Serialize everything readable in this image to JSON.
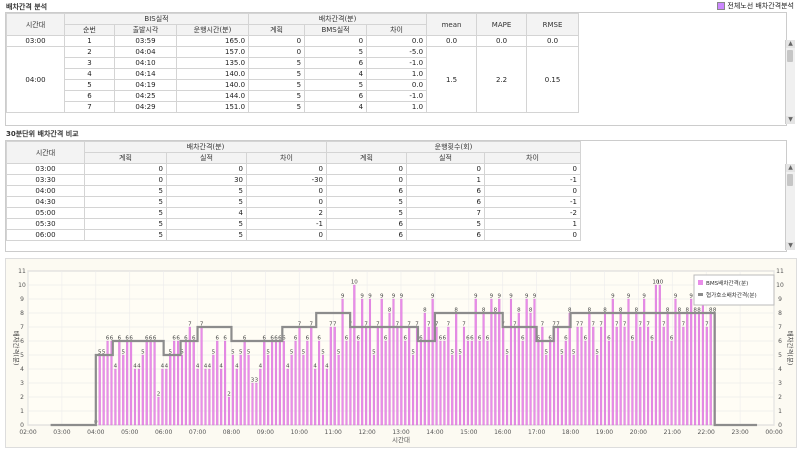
{
  "section1": {
    "title": "배차간격 분석",
    "checkbox_label": "전체노선 배차간격분석",
    "headers": {
      "time": "시간대",
      "group_bis": "BIS실적",
      "seq": "순번",
      "dep_time": "출발시각",
      "run_time": "운행시간(분)",
      "group_gap": "배차간격(분)",
      "plan": "계획",
      "bms": "BMS실적",
      "diff": "차이",
      "mean": "mean",
      "mape": "MAPE",
      "rmse": "RMSE"
    },
    "rows": [
      {
        "time": "03:00",
        "seq": "1",
        "dep": "03:59",
        "run": "165.0",
        "plan": "0",
        "bms": "0",
        "diff": "0.0",
        "mean": "0.0",
        "mape": "0.0",
        "rmse": "0.0"
      },
      {
        "time": "",
        "seq": "2",
        "dep": "04:04",
        "run": "157.0",
        "plan": "0",
        "bms": "5",
        "diff": "-5.0",
        "mean": "",
        "mape": "",
        "rmse": ""
      },
      {
        "time": "",
        "seq": "3",
        "dep": "04:10",
        "run": "135.0",
        "plan": "5",
        "bms": "6",
        "diff": "-1.0",
        "mean": "",
        "mape": "",
        "rmse": ""
      },
      {
        "time": "04:00",
        "seq": "4",
        "dep": "04:14",
        "run": "140.0",
        "plan": "5",
        "bms": "4",
        "diff": "1.0",
        "mean": "1.5",
        "mape": "2.2",
        "rmse": "0.15"
      },
      {
        "time": "",
        "seq": "5",
        "dep": "04:19",
        "run": "140.0",
        "plan": "5",
        "bms": "5",
        "diff": "0.0",
        "mean": "",
        "mape": "",
        "rmse": ""
      },
      {
        "time": "",
        "seq": "6",
        "dep": "04:25",
        "run": "144.0",
        "plan": "5",
        "bms": "6",
        "diff": "-1.0",
        "mean": "",
        "mape": "",
        "rmse": ""
      },
      {
        "time": "",
        "seq": "7",
        "dep": "04:29",
        "run": "151.0",
        "plan": "5",
        "bms": "4",
        "diff": "1.0",
        "mean": "",
        "mape": "",
        "rmse": ""
      }
    ]
  },
  "section2": {
    "title": "30분단위 배차간격 비교",
    "headers": {
      "time": "시간대",
      "group_gap": "배차간격(분)",
      "group_runs": "운행횟수(회)",
      "plan": "계획",
      "actual": "실적",
      "diff": "차이"
    },
    "rows": [
      {
        "time": "03:00",
        "gp": "0",
        "ga": "0",
        "gd": "0",
        "rp": "0",
        "ra": "0",
        "rd": "0"
      },
      {
        "time": "03:30",
        "gp": "0",
        "ga": "30",
        "gd": "-30",
        "rp": "0",
        "ra": "1",
        "rd": "-1"
      },
      {
        "time": "04:00",
        "gp": "5",
        "ga": "5",
        "gd": "0",
        "rp": "6",
        "ra": "6",
        "rd": "0"
      },
      {
        "time": "04:30",
        "gp": "5",
        "ga": "5",
        "gd": "0",
        "rp": "5",
        "ra": "6",
        "rd": "-1"
      },
      {
        "time": "05:00",
        "gp": "5",
        "ga": "4",
        "gd": "2",
        "rp": "5",
        "ra": "7",
        "rd": "-2"
      },
      {
        "time": "05:30",
        "gp": "5",
        "ga": "5",
        "gd": "-1",
        "rp": "6",
        "ra": "5",
        "rd": "1"
      },
      {
        "time": "06:00",
        "gp": "5",
        "ga": "5",
        "gd": "0",
        "rp": "6",
        "ra": "6",
        "rd": "0"
      }
    ]
  },
  "chart_data": {
    "type": "bar",
    "xlabel": "시간대",
    "ylabel_left": "배차간격(분)",
    "ylabel_right": "배차간격(분)",
    "ylim": [
      0,
      11
    ],
    "yticks": [
      0,
      1,
      2,
      3,
      4,
      5,
      6,
      7,
      8,
      9,
      10,
      11
    ],
    "x_ticks": [
      "02:00",
      "03:00",
      "04:00",
      "05:00",
      "06:00",
      "07:00",
      "08:00",
      "09:00",
      "10:00",
      "11:00",
      "12:00",
      "13:00",
      "14:00",
      "15:00",
      "16:00",
      "17:00",
      "18:00",
      "19:00",
      "20:00",
      "21:00",
      "22:00",
      "23:00",
      "00:00"
    ],
    "legend_position": "top-right",
    "series": [
      {
        "name": "BMS배차간격(분)",
        "color": "#e98de9",
        "kind": "bar",
        "x_start": "04:00",
        "x_end": "22:15",
        "values": [
          0,
          5,
          5,
          6,
          6,
          4,
          6,
          5,
          6,
          6,
          4,
          4,
          5,
          6,
          6,
          6,
          2,
          4,
          4,
          5,
          6,
          6,
          5,
          6,
          7,
          6,
          4,
          7,
          4,
          4,
          5,
          6,
          4,
          6,
          2,
          5,
          4,
          5,
          6,
          5,
          3,
          3,
          4,
          6,
          5,
          6,
          6,
          6,
          6,
          4,
          5,
          6,
          7,
          5,
          6,
          7,
          4,
          6,
          5,
          4,
          7,
          7,
          5,
          9,
          6,
          7,
          10,
          6,
          9,
          7,
          9,
          5,
          7,
          9,
          6,
          8,
          9,
          7,
          9,
          6,
          7,
          5,
          7,
          6,
          8,
          7,
          9,
          7,
          6,
          6,
          7,
          5,
          8,
          5,
          7,
          6,
          6,
          9,
          6,
          8,
          6,
          9,
          8,
          9,
          7,
          5,
          9,
          7,
          8,
          6,
          9,
          8,
          9,
          6,
          7,
          5,
          6,
          7,
          7,
          5,
          6,
          8,
          5,
          7,
          7,
          6,
          8,
          7,
          5,
          7,
          8,
          6,
          9,
          7,
          8,
          7,
          9,
          6,
          8,
          7,
          9,
          7,
          6,
          10,
          10,
          7,
          8,
          6,
          9,
          8,
          7,
          8,
          9,
          8,
          8,
          9,
          7,
          8,
          8
        ]
      },
      {
        "name": "협가호소배차간격(분)",
        "color": "#8c8c8c",
        "kind": "step",
        "steps": [
          [
            "02:40",
            0
          ],
          [
            "03:30",
            0
          ],
          [
            "04:00",
            5
          ],
          [
            "04:30",
            6
          ],
          [
            "05:30",
            6
          ],
          [
            "06:00",
            5
          ],
          [
            "06:30",
            6
          ],
          [
            "07:00",
            7
          ],
          [
            "08:00",
            6
          ],
          [
            "08:30",
            6
          ],
          [
            "09:30",
            7
          ],
          [
            "10:30",
            8
          ],
          [
            "11:30",
            7
          ],
          [
            "12:30",
            7
          ],
          [
            "13:30",
            6
          ],
          [
            "14:00",
            8
          ],
          [
            "16:00",
            7
          ],
          [
            "17:00",
            6
          ],
          [
            "17:30",
            7
          ],
          [
            "18:00",
            8
          ],
          [
            "22:15",
            8
          ],
          [
            "22:15",
            0
          ],
          [
            "23:30",
            0
          ]
        ]
      }
    ]
  }
}
